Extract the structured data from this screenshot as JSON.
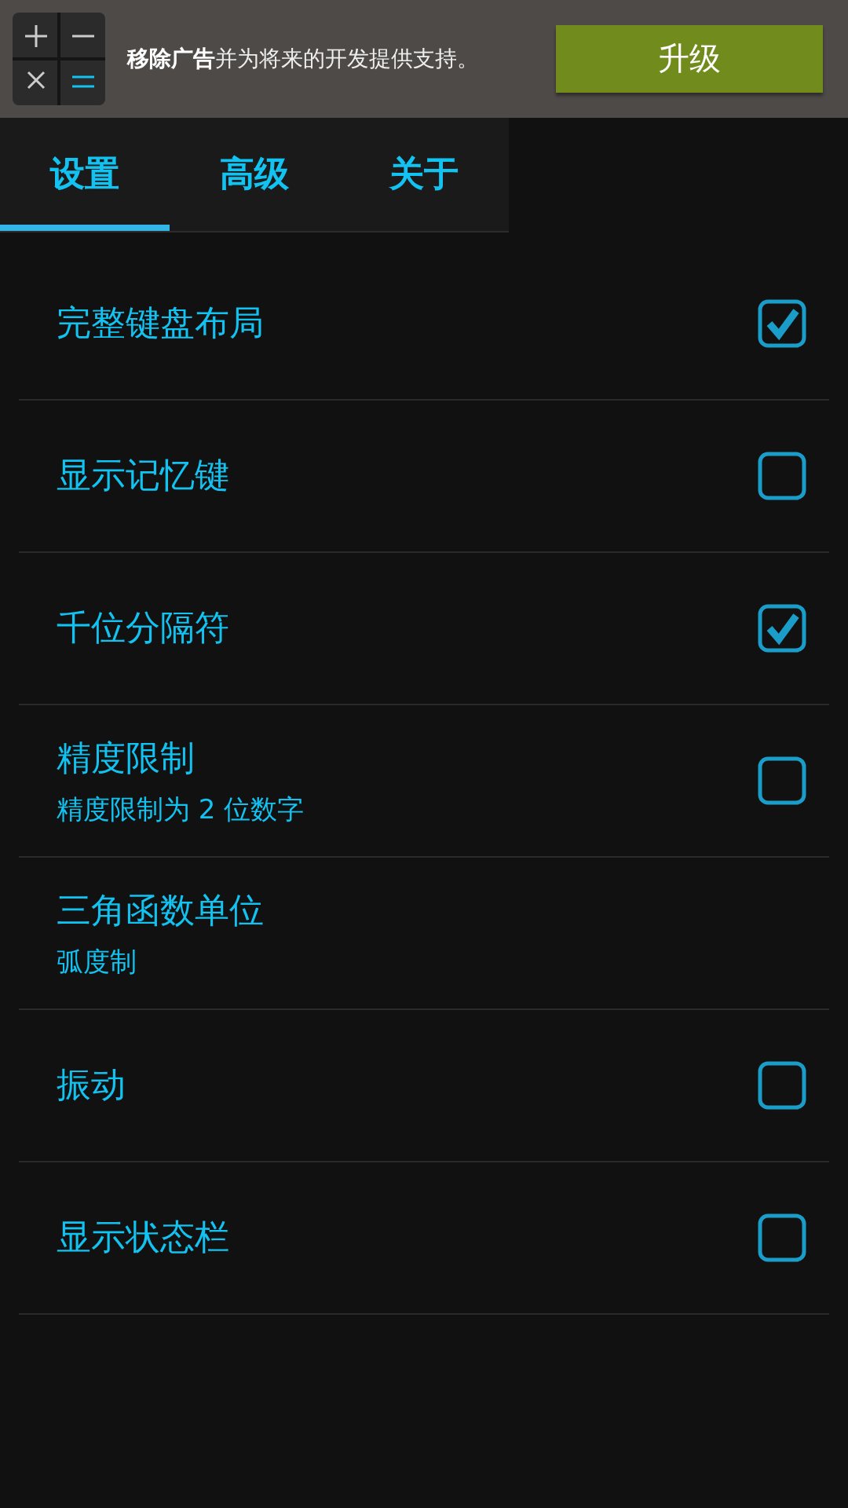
{
  "ad_banner": {
    "text": "**移除广告**并为将来的开发提供支持。",
    "button": "升级"
  },
  "tabs": [
    {
      "label": "设置",
      "selected": true
    },
    {
      "label": "高级",
      "selected": false
    },
    {
      "label": "关于",
      "selected": false
    }
  ],
  "settings": [
    {
      "kind": "checkbox",
      "title": "完整键盘布局",
      "checked": true
    },
    {
      "kind": "checkbox",
      "title": "显示记忆键",
      "checked": false
    },
    {
      "kind": "checkbox",
      "title": "千位分隔符",
      "checked": true
    },
    {
      "kind": "checkbox",
      "title": "精度限制",
      "summary": "精度限制为 2 位数字",
      "checked": false
    },
    {
      "kind": "info",
      "title": "三角函数单位",
      "summary": "弧度制"
    },
    {
      "kind": "checkbox",
      "title": "振动",
      "checked": false
    },
    {
      "kind": "checkbox",
      "title": "显示状态栏",
      "checked": false
    }
  ]
}
